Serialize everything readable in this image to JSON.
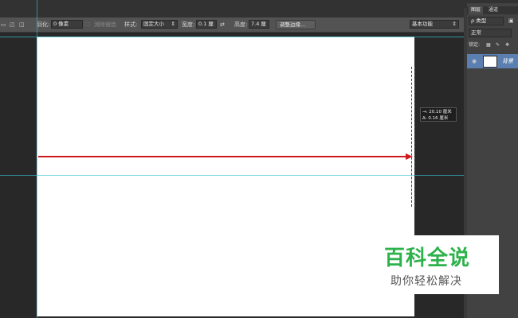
{
  "options_bar": {
    "feather_label": "羽化:",
    "feather_value": "0 像素",
    "antialias_label": "消除锯齿",
    "style_label": "样式:",
    "style_value": "固定大小",
    "width_label": "宽度:",
    "width_value": "0.1 厘",
    "height_label": "高度:",
    "height_value": "7.4 厘",
    "refine_edge_button": "调整边缘...",
    "workspace_value": "基本功能"
  },
  "layers_panel": {
    "tabs": [
      "图层",
      "通道"
    ],
    "filter_kind": "ρ 类型",
    "blend_mode": "正常",
    "lock_label": "锁定:",
    "background_layer_name": "背景"
  },
  "measure_readout": {
    "line1": "→: 20.10 厘米",
    "line2": "Δ:   0.16 厘米"
  },
  "watermark": {
    "title": "百科全说",
    "subtitle": "助你轻松解决"
  },
  "colors": {
    "arrow": "#d0191b",
    "guide": "#36c5d6",
    "watermark_green": "#2db24b",
    "selected_layer": "#5a7fb0"
  }
}
